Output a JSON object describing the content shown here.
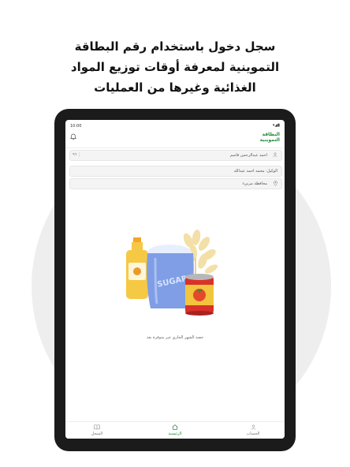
{
  "headline": {
    "line1": "سجل دخول باستخدام رقم البطاقة",
    "line2": "التموينية لمعرفة أوقات توزيع المواد",
    "line3": "الغذائية وغيرها من العمليات"
  },
  "status_bar": {
    "time": "10:00",
    "icons": "▾◢▮"
  },
  "app": {
    "logo_line1": "البطاقة",
    "logo_line2": "التموينية"
  },
  "icons": {
    "bell": "bell-icon",
    "user": "user-icon",
    "location": "location-pin-icon",
    "home": "home-icon",
    "book": "book-icon"
  },
  "cards": {
    "holder_name": "احمد عبدالرحمن قاسم",
    "holder_badge": "٩٦",
    "agent": "الوكيل: محمد احمد عبدالله",
    "governorate": "محافظة مزبيء"
  },
  "empty_state": {
    "message": "حصة الشهر الجاري غير متوفرة بعد"
  },
  "illustration": {
    "sugar_label": "SUGAR"
  },
  "bottom_nav": {
    "left": "السجل",
    "center": "الرئيسية",
    "right": "الحساب"
  },
  "colors": {
    "accent": "#1f8a3c",
    "device": "#1b1b1b",
    "background_circle": "#eeeeee"
  }
}
